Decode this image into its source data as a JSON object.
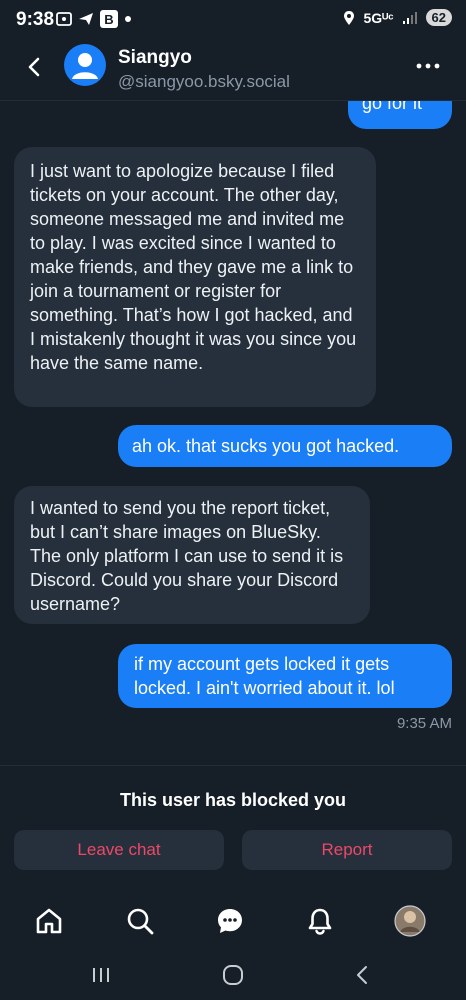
{
  "status_bar": {
    "time": "9:38",
    "network": "5Gᵁᶜ",
    "battery": "62"
  },
  "header": {
    "name": "Siangyo",
    "handle": "@siangyoo.bsky.social"
  },
  "messages": [
    {
      "from": "me",
      "text": "go for it"
    },
    {
      "from": "them",
      "text": "I just want to apologize because I filed tickets on your account. The other day, someone messaged me and invited me to play. I was excited since I wanted to make friends, and they gave me a link to join a tournament or register for something. That’s how I got hacked, and I mistakenly thought it was you since you have the same name."
    },
    {
      "from": "me",
      "text": "ah ok. that sucks you got hacked."
    },
    {
      "from": "them",
      "text": "I wanted to send you the report ticket, but I can’t share images on BlueSky. The only platform I can use to send it is Discord. Could you share your Discord username?"
    },
    {
      "from": "me",
      "text": "if my account gets locked it gets locked. I ain't worried about it. lol"
    }
  ],
  "last_timestamp": "9:35 AM",
  "blocked": {
    "text": "This user has blocked you",
    "leave_label": "Leave chat",
    "report_label": "Report"
  },
  "colors": {
    "accent": "#1a7ef6",
    "danger": "#ec4868",
    "background": "#161e27",
    "bubble_in": "#25303c"
  },
  "tabs": [
    "home-icon",
    "search-icon",
    "chat-icon",
    "bell-icon",
    "profile-avatar"
  ],
  "system_nav": [
    "recents-icon",
    "home-circle-icon",
    "back-chevron-icon"
  ]
}
